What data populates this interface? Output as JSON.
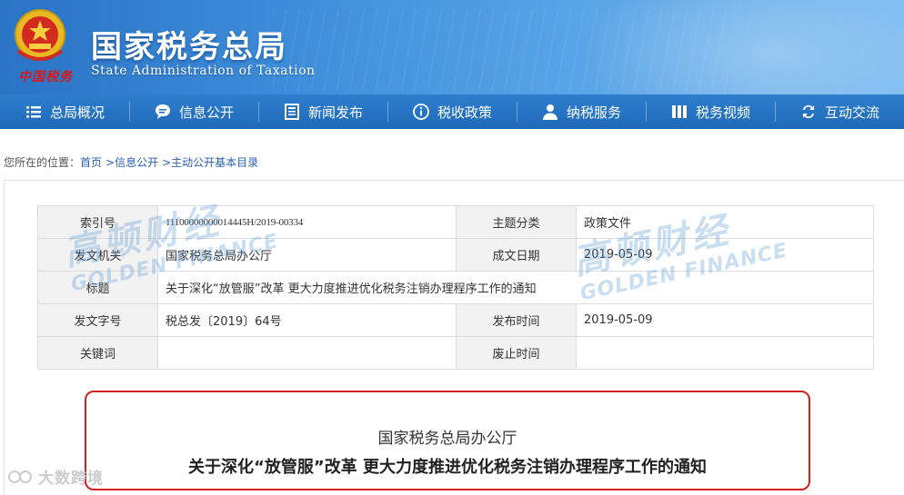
{
  "header": {
    "title": "国家税务总局",
    "subtitle": "State Administration of Taxation",
    "brand_small": "中国税务"
  },
  "nav": [
    {
      "label": "总局概况",
      "icon": "menu-list-icon"
    },
    {
      "label": "信息公开",
      "icon": "chat-bubble-icon"
    },
    {
      "label": "新闻发布",
      "icon": "newspaper-icon"
    },
    {
      "label": "税收政策",
      "icon": "info-circle-icon"
    },
    {
      "label": "纳税服务",
      "icon": "person-icon"
    },
    {
      "label": "税务视频",
      "icon": "film-icon"
    },
    {
      "label": "互动交流",
      "icon": "refresh-arrows-icon"
    }
  ],
  "breadcrumb": {
    "prefix": "您所在的位置：",
    "items": [
      "首页",
      "信息公开",
      "主动公开基本目录"
    ]
  },
  "meta": {
    "index_label": "索引号",
    "index_value": "11100000000014445H/2019-00334",
    "topic_label": "主题分类",
    "topic_value": "政策文件",
    "issuer_label": "发文机关",
    "issuer_value": "国家税务总局办公厅",
    "created_label": "成文日期",
    "created_value": "2019-05-09",
    "title_label": "标题",
    "title_value": "关于深化“放管服”改革 更大力度推进优化税务注销办理程序工作的通知",
    "docno_label": "发文字号",
    "docno_value": "税总发〔2019〕64号",
    "published_label": "发布时间",
    "published_value": "2019-05-09",
    "keywords_label": "关键词",
    "keywords_value": "",
    "expiry_label": "废止时间",
    "expiry_value": ""
  },
  "watermark": {
    "cn": "高顿财经",
    "en": "GOLDEN FINANCE"
  },
  "notice": {
    "org": "国家税务总局办公厅",
    "title": "关于深化“放管服”改革 更大力度推进优化税务注销办理程序工作的通知"
  },
  "corner_watermark": "大数跨境",
  "colors": {
    "nav_bg": "#1f69b8",
    "header_bg": "#3f8fdb",
    "link": "#2a62b5",
    "notice_border": "#d42020"
  }
}
